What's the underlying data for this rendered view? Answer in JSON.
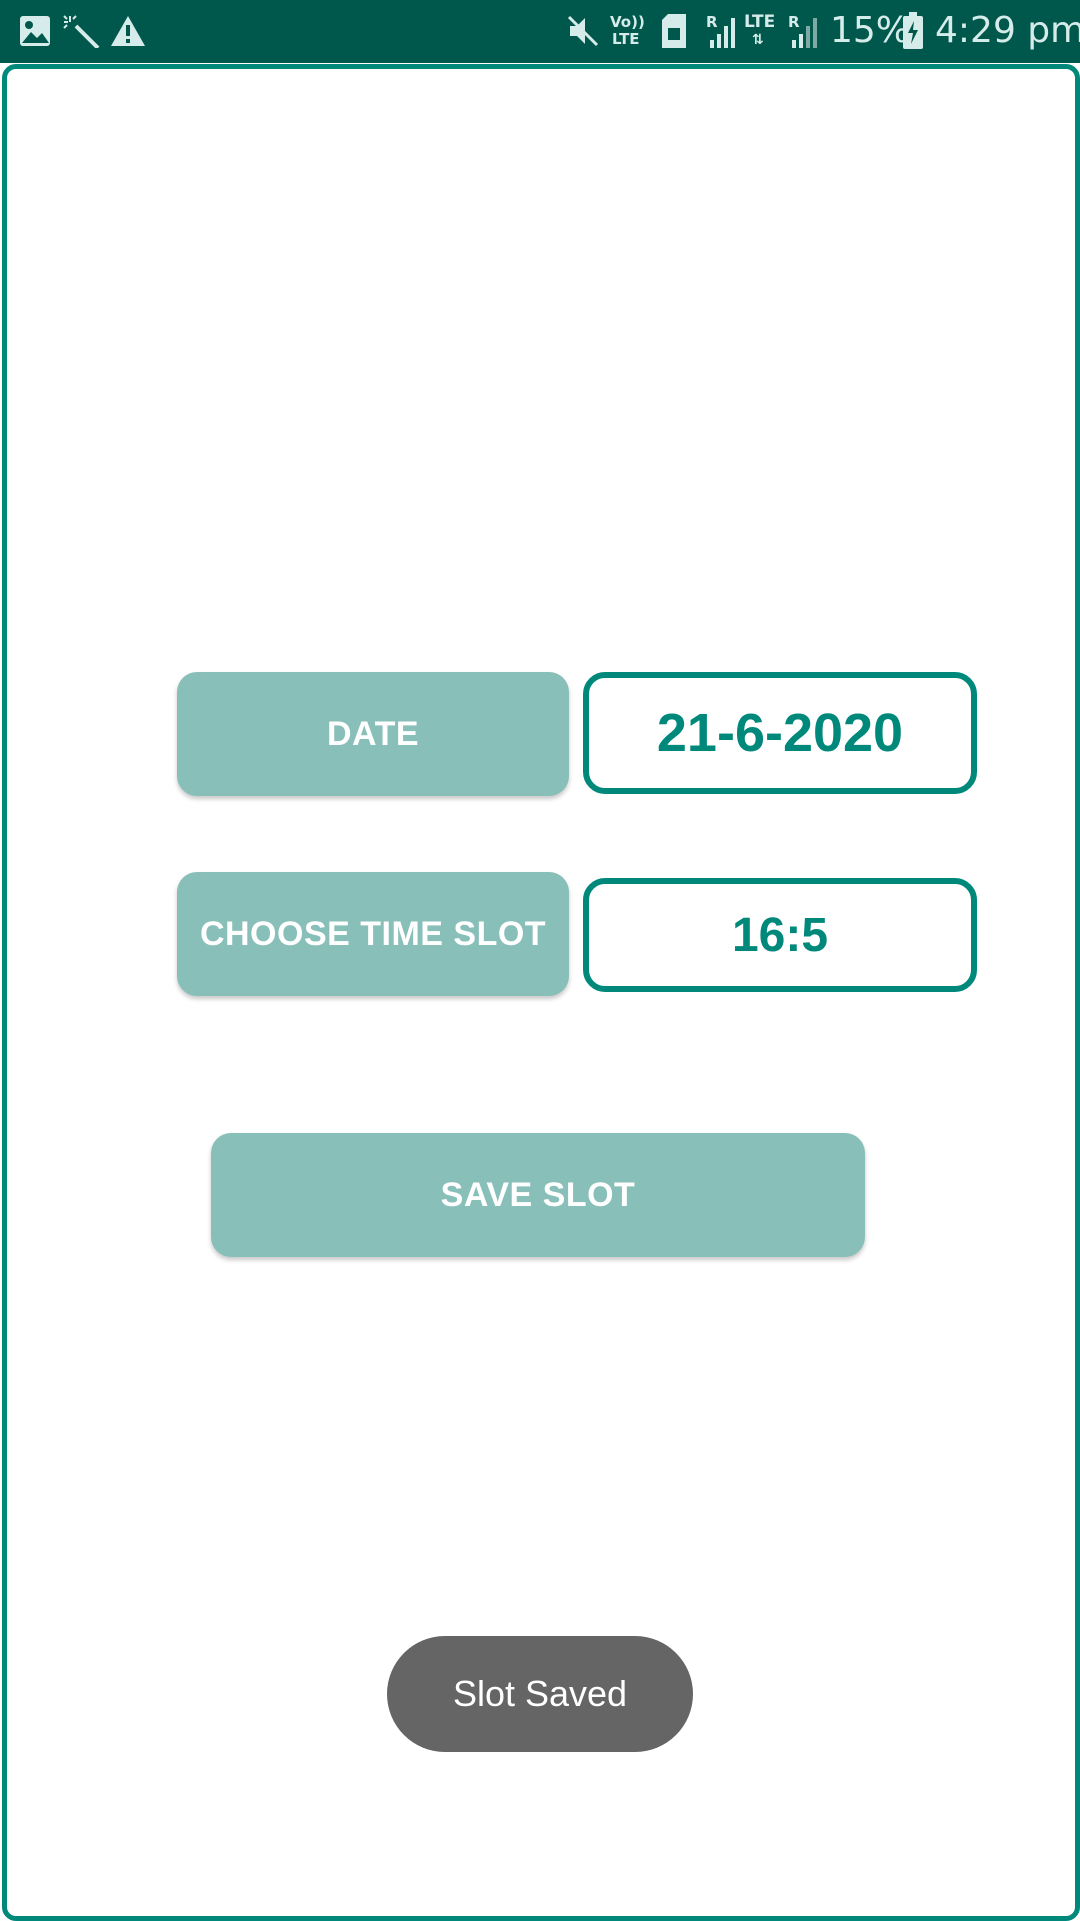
{
  "status_bar": {
    "icons_left": [
      "image-icon",
      "magic-wand-icon",
      "warning-icon"
    ],
    "icons_right": [
      "mute-icon",
      "volte-icon",
      "sim-icon",
      "signal-roaming-icon",
      "lte-data-icon",
      "signal-roaming-icon",
      "battery-charging-icon"
    ],
    "volte_top": "Vo))",
    "volte_bottom": "LTE",
    "lte_label": "LTE",
    "roaming_label": "R",
    "battery_percent": "15%",
    "time": "4:29 pm"
  },
  "form": {
    "date_button_label": "DATE",
    "date_value": "21-6-2020",
    "time_button_label": "CHOOSE TIME SLOT",
    "time_value": "16:5",
    "save_button_label": "SAVE SLOT"
  },
  "toast": {
    "message": "Slot Saved"
  },
  "colors": {
    "status_bar": "#00574b",
    "accent": "#00897b",
    "button": "#89bfb9",
    "toast": "#656565"
  }
}
